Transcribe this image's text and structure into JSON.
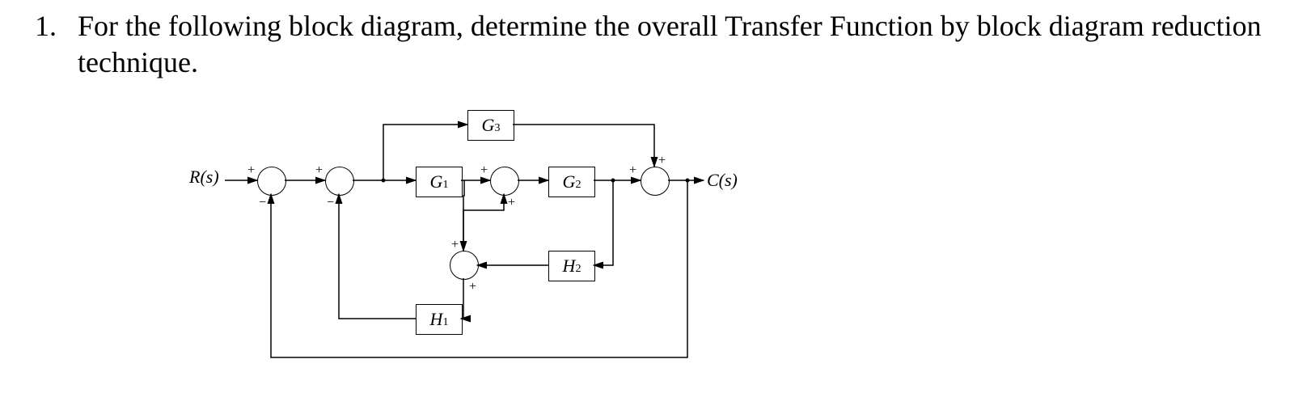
{
  "question": {
    "number": "1.",
    "text": "For the following block diagram, determine the overall Transfer Function by block diagram reduction technique."
  },
  "diagram": {
    "input_label": "R(s)",
    "output_label": "C(s)",
    "blocks": {
      "G1": "G",
      "G1_sub": "1",
      "G2": "G",
      "G2_sub": "2",
      "G3": "G",
      "G3_sub": "3",
      "H1": "H",
      "H1_sub": "1",
      "H2": "H",
      "H2_sub": "2"
    },
    "signs": {
      "s1_top": "+",
      "s1_bot": "−",
      "s2_top": "+",
      "s2_bot": "−",
      "s3_top": "+",
      "s3_bot": "+",
      "s4_top": "+",
      "s4_left": "+",
      "s5_top": "+",
      "s5_bot": "+"
    }
  }
}
